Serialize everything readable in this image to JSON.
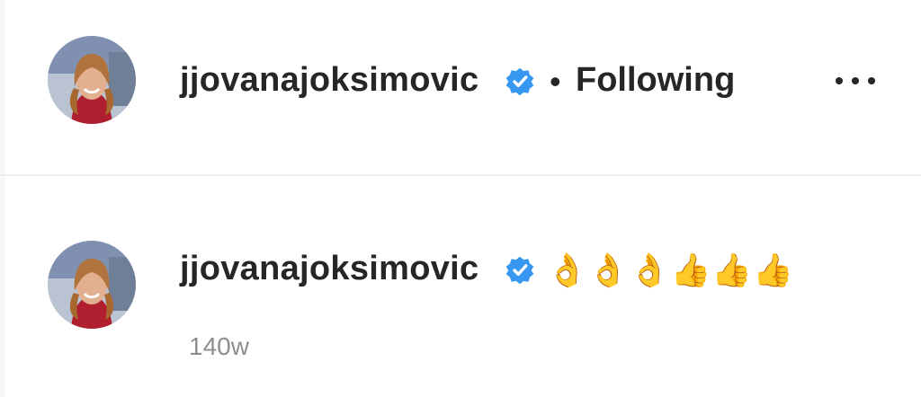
{
  "header": {
    "username": "jjovanajoksimovic",
    "separator": "•",
    "follow_status": "Following",
    "avatar_icon": "profile-avatar",
    "verified_icon": "verified-badge-icon",
    "more_icon": "more-options-icon",
    "accent_color": "#3897f0"
  },
  "comment": {
    "username": "jjovanajoksimovic",
    "text": "👌👌👌👍👍👍",
    "timestamp": "140w",
    "avatar_icon": "profile-avatar",
    "verified_icon": "verified-badge-icon"
  }
}
